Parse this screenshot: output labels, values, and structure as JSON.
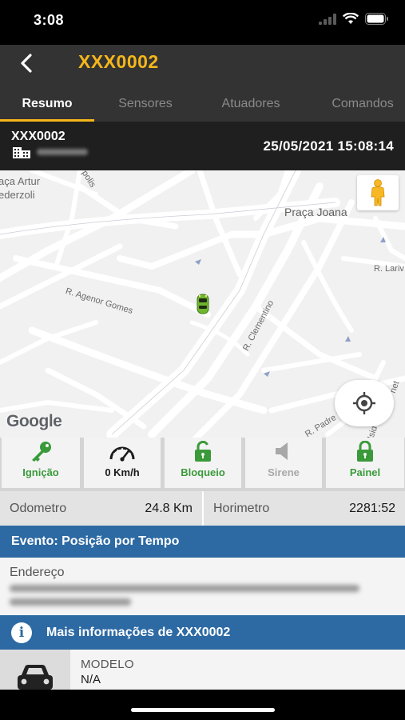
{
  "status_bar": {
    "time": "3:08"
  },
  "header": {
    "title": "XXX0002"
  },
  "tabs": [
    "Resumo",
    "Sensores",
    "Atuadores",
    "Comandos"
  ],
  "vehicle_info": {
    "plate": "XXX0002",
    "datetime": "25/05/2021 15:08:14"
  },
  "map": {
    "labels": {
      "praca_artur": "aça Artur",
      "pederzoli": "ederzoli",
      "praca_joana": "Praça Joana",
      "agenor": "R. Agenor Gomes",
      "clementino": "R. Clementino",
      "padre": "R. Padre Paulo Ravier",
      "lariv": "R. Lariv",
      "polis": "polis",
      "isid": "Isid",
      "net": "net"
    },
    "attribution": "Google"
  },
  "status_items": [
    {
      "label": "Ignição",
      "icon": "key-icon",
      "color": "#3a9a3a"
    },
    {
      "label": "0 Km/h",
      "icon": "speedometer-icon",
      "color": "#1a1a1a"
    },
    {
      "label": "Bloqueio",
      "icon": "unlock-icon",
      "color": "#3a9a3a"
    },
    {
      "label": "Sirene",
      "icon": "speaker-icon",
      "color": "#a8a8a8"
    },
    {
      "label": "Painel",
      "icon": "lock-icon",
      "color": "#3a9a3a"
    }
  ],
  "odometer": {
    "label": "Odometro",
    "value": "24.8 Km"
  },
  "hourmeter": {
    "label": "Horimetro",
    "value": "2281:52"
  },
  "event": {
    "text": "Evento: Posição por Tempo"
  },
  "address": {
    "label": "Endereço"
  },
  "more_info": {
    "text": "Mais informações de XXX0002"
  },
  "model": {
    "label": "MODELO",
    "value": "N/A"
  },
  "colors": {
    "accent": "#f5b61a",
    "header_bg": "#333333",
    "blue_bar": "#2d6aa3",
    "green": "#3a9a3a"
  }
}
